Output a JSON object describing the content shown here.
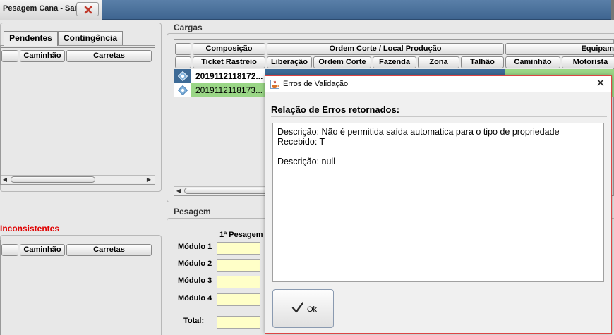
{
  "window": {
    "tab_title": "Pesagem Cana - Saída"
  },
  "left_panel": {
    "tabs": [
      "Pendentes",
      "Contingência"
    ],
    "columns": [
      "",
      "Caminhão",
      "Carretas"
    ],
    "inconsistentes_title": "Inconsistentes",
    "inconsistentes_columns": [
      "",
      "Caminhão",
      "Carretas"
    ]
  },
  "cargas": {
    "title": "Cargas",
    "group_headers": [
      "",
      "Composição",
      "Ordem Corte / Local Produção",
      "Equipam"
    ],
    "columns": [
      "",
      "Ticket Rastreio",
      "Liberação",
      "Ordem Corte",
      "Fazenda",
      "Zona",
      "Talhão",
      "Caminhão",
      "Motorista"
    ],
    "rows": [
      {
        "ticket": "2019112118172...",
        "selected": true
      },
      {
        "ticket": "2019112118173...",
        "selected": false
      }
    ]
  },
  "pesagem": {
    "title": "Pesagem",
    "column_header": "1ª Pesagem",
    "rows": [
      "Módulo 1",
      "Módulo 2",
      "Módulo 3",
      "Módulo 4"
    ],
    "total_label": "Total:"
  },
  "dialog": {
    "title": "Erros de Validação",
    "close_glyph": "✕",
    "heading": "Relação de Erros retornados:",
    "lines": [
      "Descrição: Não é permitida saída automatica para o tipo de propriedade",
      "Recebido: T",
      "",
      "Descrição: null"
    ],
    "ok_label": "Ok"
  },
  "colors": {
    "selected_row": "#3d6a96",
    "green_row": "#9ad686",
    "field_yellow": "#ffffc8",
    "alert_red": "#e00000"
  },
  "icons": {
    "close": "close-icon",
    "row": "info-diamond-icon",
    "check": "check-icon",
    "java": "java-cup-icon"
  }
}
